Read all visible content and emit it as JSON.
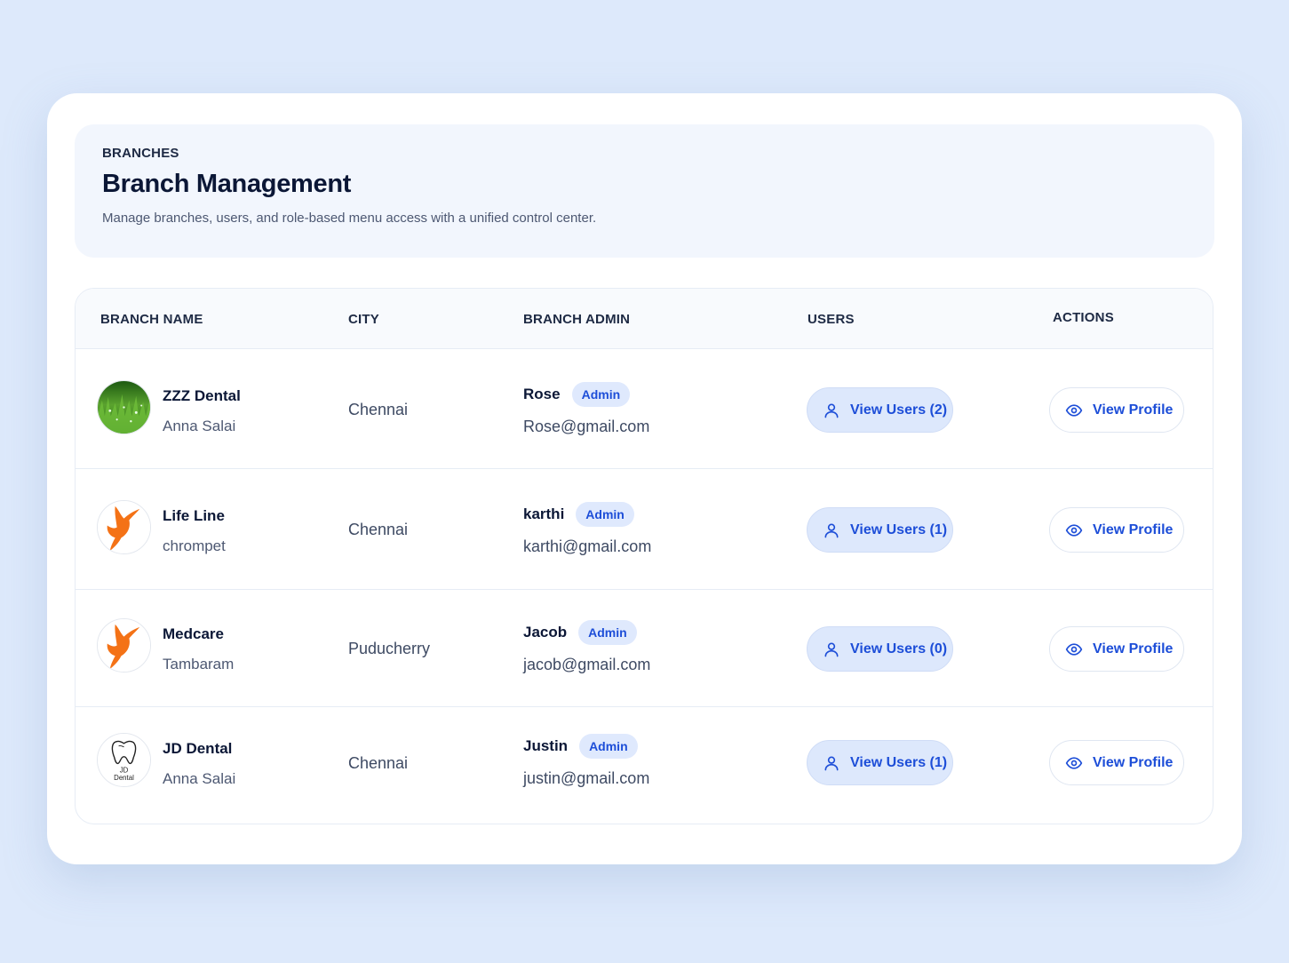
{
  "header": {
    "eyebrow": "BRANCHES",
    "title": "Branch Management",
    "subtitle": "Manage branches, users, and role-based menu access with a unified control center."
  },
  "table": {
    "columns": [
      "BRANCH NAME",
      "CITY",
      "BRANCH ADMIN",
      "USERS",
      "ACTIONS"
    ],
    "rows": [
      {
        "name": "ZZZ Dental",
        "area": "Anna Salai",
        "city": "Chennai",
        "admin": "Rose",
        "role": "Admin",
        "email": "Rose@gmail.com",
        "users_label": "View Users (2)",
        "action_label": "View Profile",
        "avatar_icon": "grass-photo-icon"
      },
      {
        "name": "Life Line",
        "area": "chrompet",
        "city": "Chennai",
        "admin": "karthi",
        "role": "Admin",
        "email": "karthi@gmail.com",
        "users_label": "View Users (1)",
        "action_label": "View Profile",
        "avatar_icon": "orange-dancer-logo-icon"
      },
      {
        "name": "Medcare",
        "area": "Tambaram",
        "city": "Puducherry",
        "admin": "Jacob",
        "role": "Admin",
        "email": "jacob@gmail.com",
        "users_label": "View Users (0)",
        "action_label": "View Profile",
        "avatar_icon": "orange-dancer-logo-icon"
      },
      {
        "name": "JD Dental",
        "area": "Anna Salai",
        "city": "Chennai",
        "admin": "Justin",
        "role": "Admin",
        "email": "justin@gmail.com",
        "users_label": "View Users (1)",
        "action_label": "View Profile",
        "avatar_icon": "tooth-logo-icon",
        "avatar_text": [
          "JD",
          "Dental"
        ]
      }
    ]
  },
  "icons": {
    "users_button": "user-icon",
    "profile_button": "eye-icon"
  },
  "colors": {
    "accent": "#1d4ed8",
    "badge_bg": "#dfe9fd",
    "page_bg": "#dde9fb",
    "dancer_orange": "#f47216"
  }
}
